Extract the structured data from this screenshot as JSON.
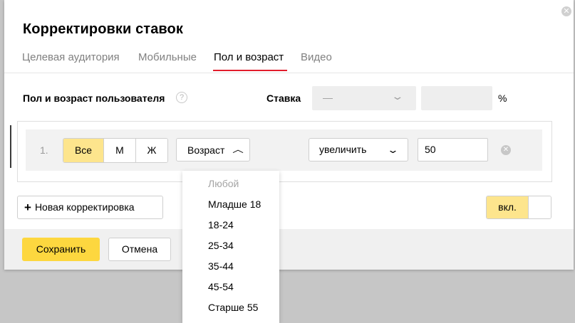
{
  "dialog": {
    "title": "Корректировки ставок",
    "close_icon": "close-icon"
  },
  "tabs": [
    {
      "label": "Целевая аудитория",
      "active": false
    },
    {
      "label": "Мобильные",
      "active": false
    },
    {
      "label": "Пол и возраст",
      "active": true
    },
    {
      "label": "Видео",
      "active": false
    }
  ],
  "section": {
    "label": "Пол и возраст пользователя",
    "help": "?",
    "rate_label": "Ставка",
    "rate_select_value": "—",
    "rate_input_value": "",
    "percent": "%"
  },
  "row": {
    "number": "1.",
    "gender_options": [
      {
        "label": "Все",
        "selected": true
      },
      {
        "label": "М",
        "selected": false
      },
      {
        "label": "Ж",
        "selected": false
      }
    ],
    "age_button": "Возраст",
    "action_select": "увеличить",
    "value": "50"
  },
  "age_dropdown": {
    "items": [
      "Любой",
      "Младше 18",
      "18-24",
      "25-34",
      "35-44",
      "45-54",
      "Старше 55"
    ]
  },
  "buttons": {
    "new_adjustment": "Новая корректировка",
    "toggle_on": "вкл.",
    "save": "Сохранить",
    "cancel": "Отмена"
  },
  "colors": {
    "accent_yellow": "#fdd73f",
    "selected_yellow": "#fde58d",
    "tab_underline": "#e21d2c"
  }
}
